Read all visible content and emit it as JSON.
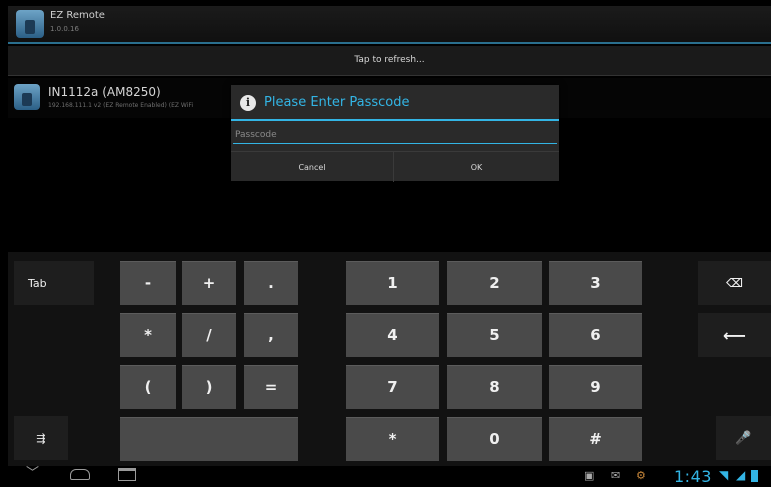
{
  "app": {
    "title": "EZ Remote",
    "version": "1.0.0.16"
  },
  "refresh_label": "Tap to refresh...",
  "device": {
    "name": "IN1112a (AM8250)",
    "details": "192.168.111.1 v2 (EZ Remote Enabled) (EZ WiFi"
  },
  "dialog": {
    "title": "Please Enter Passcode",
    "input_placeholder": "Passcode",
    "input_value": "",
    "cancel_label": "Cancel",
    "ok_label": "OK"
  },
  "keyboard": {
    "tab_label": "Tab",
    "symbols": [
      "-",
      "+",
      ".",
      "*",
      "/",
      ",",
      "(",
      ")",
      "="
    ],
    "digits": [
      "1",
      "2",
      "3",
      "4",
      "5",
      "6",
      "7",
      "8",
      "9"
    ],
    "bottom": [
      "*",
      "0",
      "#"
    ],
    "icons": {
      "backspace": "backspace-icon",
      "enter": "enter-icon",
      "settings": "keyboard-settings-icon",
      "mic": "microphone-icon"
    }
  },
  "statusbar": {
    "time": "1:43"
  },
  "colors": {
    "accent": "#33b5e5",
    "key": "#4a4a4a",
    "background": "#000000"
  }
}
